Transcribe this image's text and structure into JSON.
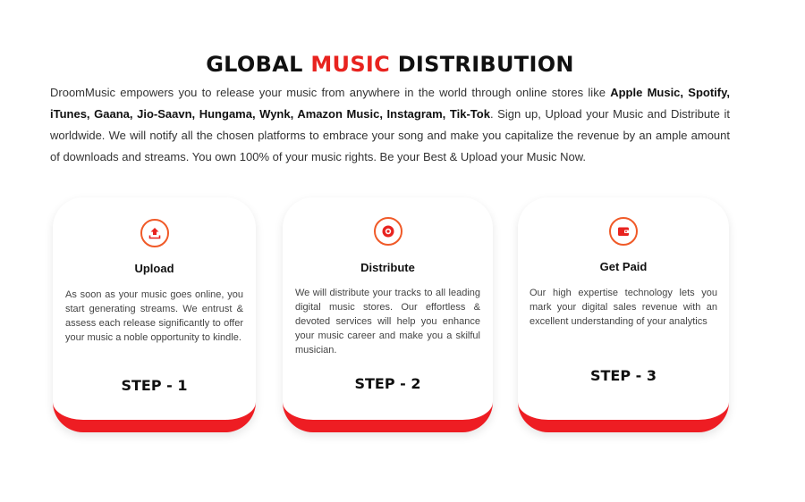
{
  "headline": {
    "part1": "GLOBAL ",
    "accent": "MUSIC",
    "part2": " DISTRIBUTION"
  },
  "intro": {
    "lead": "DroomMusic empowers you to release your music from anywhere in the world through online stores like ",
    "stores": "Apple Music, Spotify, iTunes, Gaana, Jio-Saavn, Hungama, Wynk, Amazon Music, Instagram, Tik-Tok",
    "tail": ". Sign up, Upload your Music and Distribute it worldwide. We will notify all the chosen platforms to embrace your song and make you capitalize the revenue by an ample amount of downloads and streams. You own 100% of your music rights. Be your Best & Upload your Music Now."
  },
  "cards": [
    {
      "icon": "upload-icon",
      "title": "Upload",
      "text": "As soon as your music goes online, you start generating streams. We entrust & assess each release significantly to offer your music a noble opportunity to kindle.",
      "step": "STEP - 1"
    },
    {
      "icon": "disc-icon",
      "title": "Distribute",
      "text": "We will distribute your tracks to all leading digital music stores. Our effortless & devoted services will help you enhance your music career and make you a skilful musician.",
      "step": "STEP - 2"
    },
    {
      "icon": "wallet-icon",
      "title": "Get Paid",
      "text": "Our high expertise technology lets you mark your digital sales revenue with an excellent understanding of your analytics",
      "step": "STEP - 3"
    }
  ],
  "colors": {
    "accent": "#e8231f",
    "card_bottom": "#ee1d23",
    "icon": "#f05a28"
  }
}
